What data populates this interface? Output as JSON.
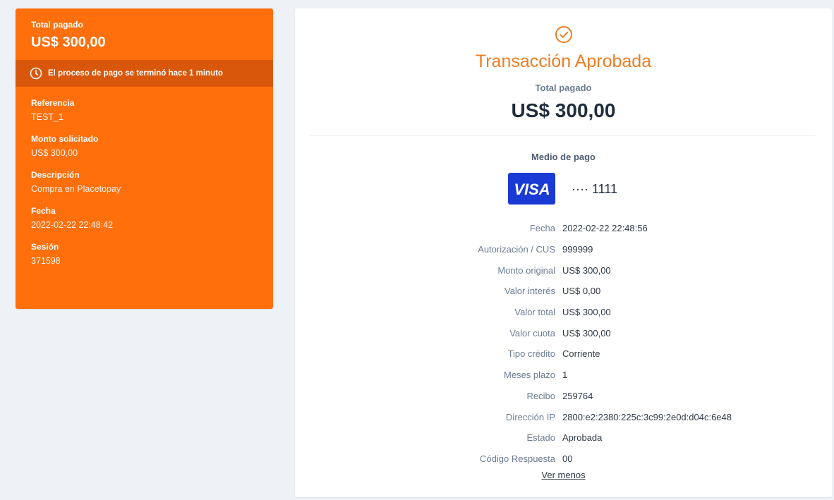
{
  "left": {
    "total_label": "Total pagado",
    "total_amount": "US$ 300,00",
    "process_message": "El proceso de pago se terminó hace 1 minuto",
    "fields": [
      {
        "label": "Referencia",
        "value": "TEST_1"
      },
      {
        "label": "Monto solicitado",
        "value": "US$ 300,00"
      },
      {
        "label": "Descripción",
        "value": "Compra en Placetopay"
      },
      {
        "label": "Fecha",
        "value": "2022-02-22 22:48:42"
      },
      {
        "label": "Sesión",
        "value": "371598"
      }
    ]
  },
  "right": {
    "status_title": "Transacción Aprobada",
    "total_label": "Total pagado",
    "total_amount": "US$ 300,00",
    "payment_method_label": "Medio de pago",
    "card_brand": "VISA",
    "card_number": "···· 1111",
    "details": [
      {
        "label": "Fecha",
        "value": "2022-02-22 22:48:56"
      },
      {
        "label": "Autorización / CUS",
        "value": "999999"
      },
      {
        "label": "Monto original",
        "value": "US$ 300,00"
      },
      {
        "label": "Valor interés",
        "value": "US$ 0,00"
      },
      {
        "label": "Valor total",
        "value": "US$ 300,00"
      },
      {
        "label": "Valor cuota",
        "value": "US$ 300,00"
      },
      {
        "label": "Tipo crédito",
        "value": "Corriente"
      },
      {
        "label": "Meses plazo",
        "value": "1"
      },
      {
        "label": "Recibo",
        "value": "259764"
      },
      {
        "label": "Dirección IP",
        "value": "2800:e2:2380:225c:3c99:2e0d:d04c:6e48"
      },
      {
        "label": "Estado",
        "value": "Aprobada"
      },
      {
        "label": "Código Respuesta",
        "value": "00"
      }
    ],
    "toggle_label": "Ver menos"
  },
  "colors": {
    "brand_orange": "#ff6f0c",
    "process_bar": "#d9570a",
    "title_orange": "#f07c22",
    "visa_blue": "#1a3ad6"
  },
  "icons": {
    "process": "clock-icon",
    "status": "check-circle-icon"
  }
}
